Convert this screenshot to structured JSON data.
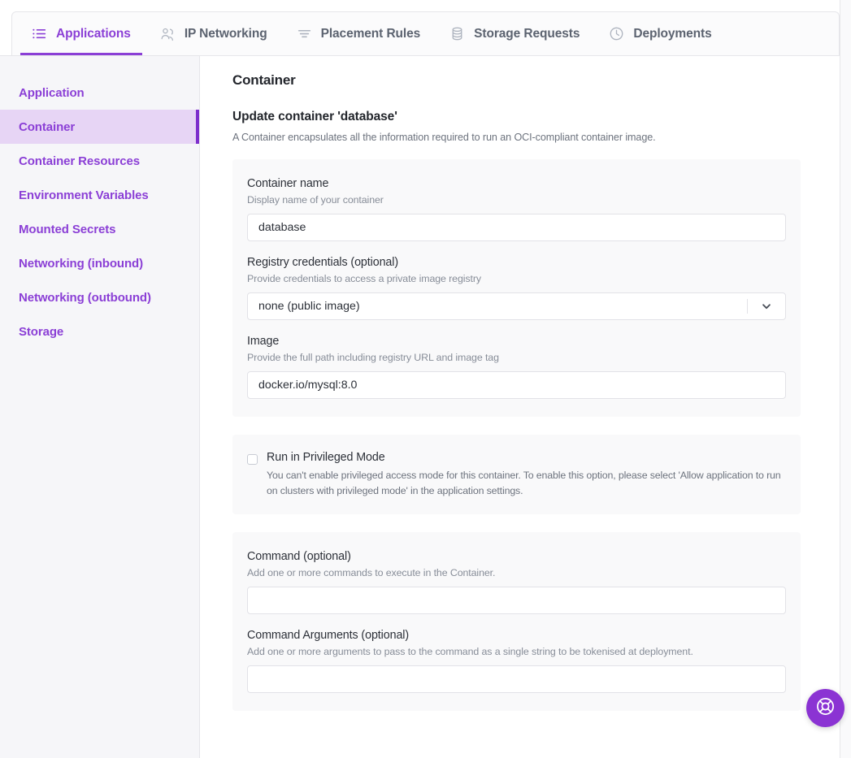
{
  "topbar": {
    "tabs": [
      {
        "label": "Applications",
        "icon": "list-icon",
        "active": true
      },
      {
        "label": "IP Networking",
        "icon": "network-icon",
        "active": false
      },
      {
        "label": "Placement Rules",
        "icon": "filter-icon",
        "active": false
      },
      {
        "label": "Storage Requests",
        "icon": "database-icon",
        "active": false
      },
      {
        "label": "Deployments",
        "icon": "clock-icon",
        "active": false
      }
    ]
  },
  "sidebar": {
    "items": [
      {
        "label": "Application",
        "active": false
      },
      {
        "label": "Container",
        "active": true
      },
      {
        "label": "Container Resources",
        "active": false
      },
      {
        "label": "Environment Variables",
        "active": false
      },
      {
        "label": "Mounted Secrets",
        "active": false
      },
      {
        "label": "Networking (inbound)",
        "active": false
      },
      {
        "label": "Networking (outbound)",
        "active": false
      },
      {
        "label": "Storage",
        "active": false
      }
    ]
  },
  "main": {
    "page_title": "Container",
    "section_title": "Update container 'database'",
    "section_sub": "A Container encapsulates all the information required to run an OCI-compliant container image.",
    "fields": {
      "container_name": {
        "label": "Container name",
        "help": "Display name of your container",
        "value": "database",
        "placeholder": ""
      },
      "registry_credentials": {
        "label": "Registry credentials (optional)",
        "help": "Provide credentials to access a private image registry",
        "selected": "none (public image)"
      },
      "image": {
        "label": "Image",
        "help": "Provide the full path including registry URL and image tag",
        "value": "docker.io/mysql:8.0",
        "placeholder": ""
      },
      "privileged_mode": {
        "label": "Run in Privileged Mode",
        "description": "You can't enable privileged access mode for this container. To enable this option, please select 'Allow application to run on clusters with privileged mode' in the application settings.",
        "checked": false
      },
      "command": {
        "label": "Command (optional)",
        "help": "Add one or more commands to execute in the Container.",
        "value": "",
        "placeholder": ""
      },
      "command_args": {
        "label": "Command Arguments (optional)",
        "help": "Add one or more arguments to pass to the command as a single string to be tokenised at deployment.",
        "value": "",
        "placeholder": ""
      }
    }
  },
  "help_fab": {
    "icon": "lifebuoy-icon",
    "label": "Help"
  },
  "colors": {
    "accent": "#8b3fd6",
    "accent_dark": "#7d2ecc",
    "accent_soft": "#e7d5f5",
    "fab": "#8b33d3",
    "text": "#23262c",
    "muted": "#6d737e",
    "card_bg": "#f9f9fa",
    "sidebar_bg": "#f6f6f9",
    "border": "#e6e6ea"
  }
}
